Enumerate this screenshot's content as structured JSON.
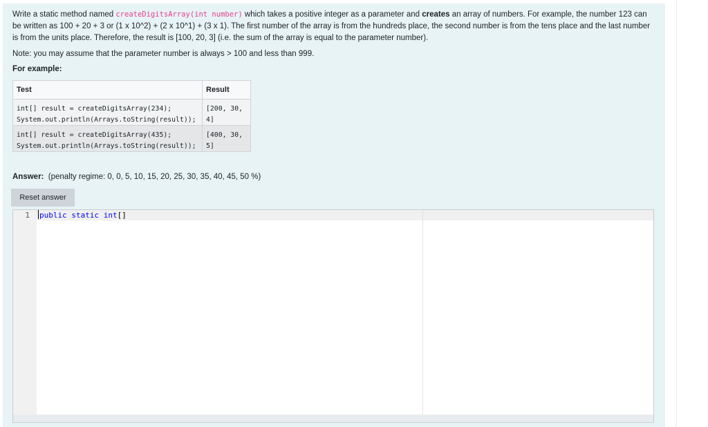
{
  "question": {
    "intro_before": "Write a static method named ",
    "method_signature": "createDigitsArray(int number)",
    "intro_mid": " which takes a positive integer as a parameter and ",
    "intro_bold": "creates",
    "intro_after": " an array of numbers. For example, the number 123 can be written as 100 + 20 + 3 or (1 x 10^2) + (2 x 10^1) + (3 x 1). The first number of the array is from the hundreds place, the second number is from the tens place and the last number is from the units place. Therefore, the result is [100, 20, 3] (i.e. the sum of the array is equal to the parameter number).",
    "note": "Note: you may assume that the parameter number is always > 100 and less than 999.",
    "for_example": "For example:"
  },
  "examples": {
    "headers": [
      "Test",
      "Result"
    ],
    "rows": [
      {
        "test_line1": "int[] result = createDigitsArray(234);",
        "test_line2": "System.out.println(Arrays.toString(result));",
        "result": "[200, 30, 4]"
      },
      {
        "test_line1": "int[] result = createDigitsArray(435);",
        "test_line2": "System.out.println(Arrays.toString(result));",
        "result": "[400, 30, 5]"
      }
    ]
  },
  "answer": {
    "label": "Answer:",
    "penalty": "(penalty regime: 0, 0, 5, 10, 15, 20, 25, 30, 35, 40, 45, 50 %)",
    "reset_label": "Reset answer"
  },
  "editor": {
    "line_number": "1",
    "code_keywords": "public static int",
    "code_rest": "[]"
  }
}
